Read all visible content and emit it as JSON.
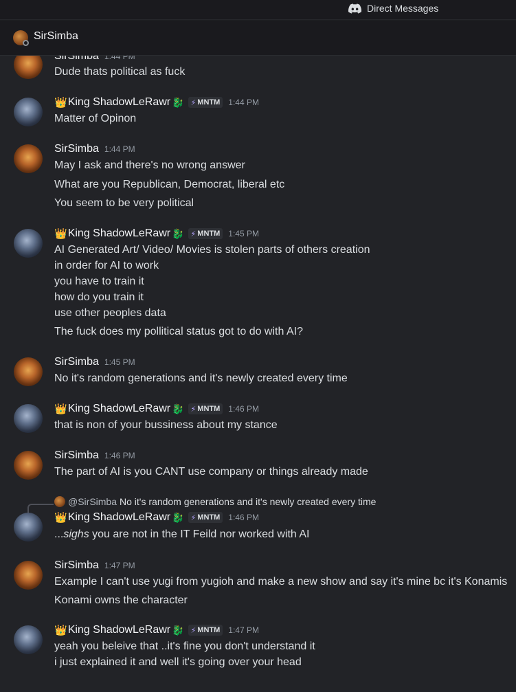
{
  "topbar": {
    "title": "Direct Messages"
  },
  "channel": {
    "name": "SirSimba"
  },
  "colors": {
    "background": "#222327",
    "accent": "#5865f2",
    "tag_bolt": "#b5a4ff"
  },
  "messages": [
    {
      "author": "SirSimba",
      "time": "1:44 PM",
      "lines": [
        "Dude thats political as fuck"
      ]
    },
    {
      "author": "King ShadowLeRawr",
      "tag": "MNTM",
      "time": "1:44 PM",
      "lines": [
        "Matter of Opinon"
      ]
    },
    {
      "author": "SirSimba",
      "time": "1:44 PM",
      "lines": [
        "May I ask and there's no wrong answer",
        "What are you Republican, Democrat, liberal etc",
        "You seem to be very political"
      ]
    },
    {
      "author": "King ShadowLeRawr",
      "tag": "MNTM",
      "time": "1:45 PM",
      "lines": [
        "AI Generated Art/ Video/ Movies is stolen parts of others creation",
        "in order for AI to work",
        "you have to train it",
        "how do you train it",
        "use other peoples data",
        "The fuck does my pollitical status got to do with AI?"
      ]
    },
    {
      "author": "SirSimba",
      "time": "1:45 PM",
      "lines": [
        "No it's random generations and it's newly created every time"
      ]
    },
    {
      "author": "King ShadowLeRawr",
      "tag": "MNTM",
      "time": "1:46 PM",
      "lines": [
        "that is non of your bussiness about my stance"
      ]
    },
    {
      "author": "SirSimba",
      "time": "1:46 PM",
      "lines": [
        "The part of AI is you CANT use company or things already made"
      ]
    },
    {
      "author": "King ShadowLeRawr",
      "tag": "MNTM",
      "time": "1:46 PM",
      "reply": {
        "name": "@SirSimba",
        "text": "No it's random generations and it's newly created every time"
      },
      "lines_rich": {
        "prefix": "...",
        "em": "sighs",
        "rest": " you are not in the IT Feild nor worked with AI"
      }
    },
    {
      "author": "SirSimba",
      "time": "1:47 PM",
      "lines": [
        "Example I can't use yugi from yugioh and make a new show and say it's mine bc it's Konamis",
        "Konami owns the character"
      ]
    },
    {
      "author": "King ShadowLeRawr",
      "tag": "MNTM",
      "time": "1:47 PM",
      "lines": [
        "yeah you beleive that ..it's fine you don't understand it",
        "i just explained it and well it's going over your head"
      ]
    }
  ]
}
